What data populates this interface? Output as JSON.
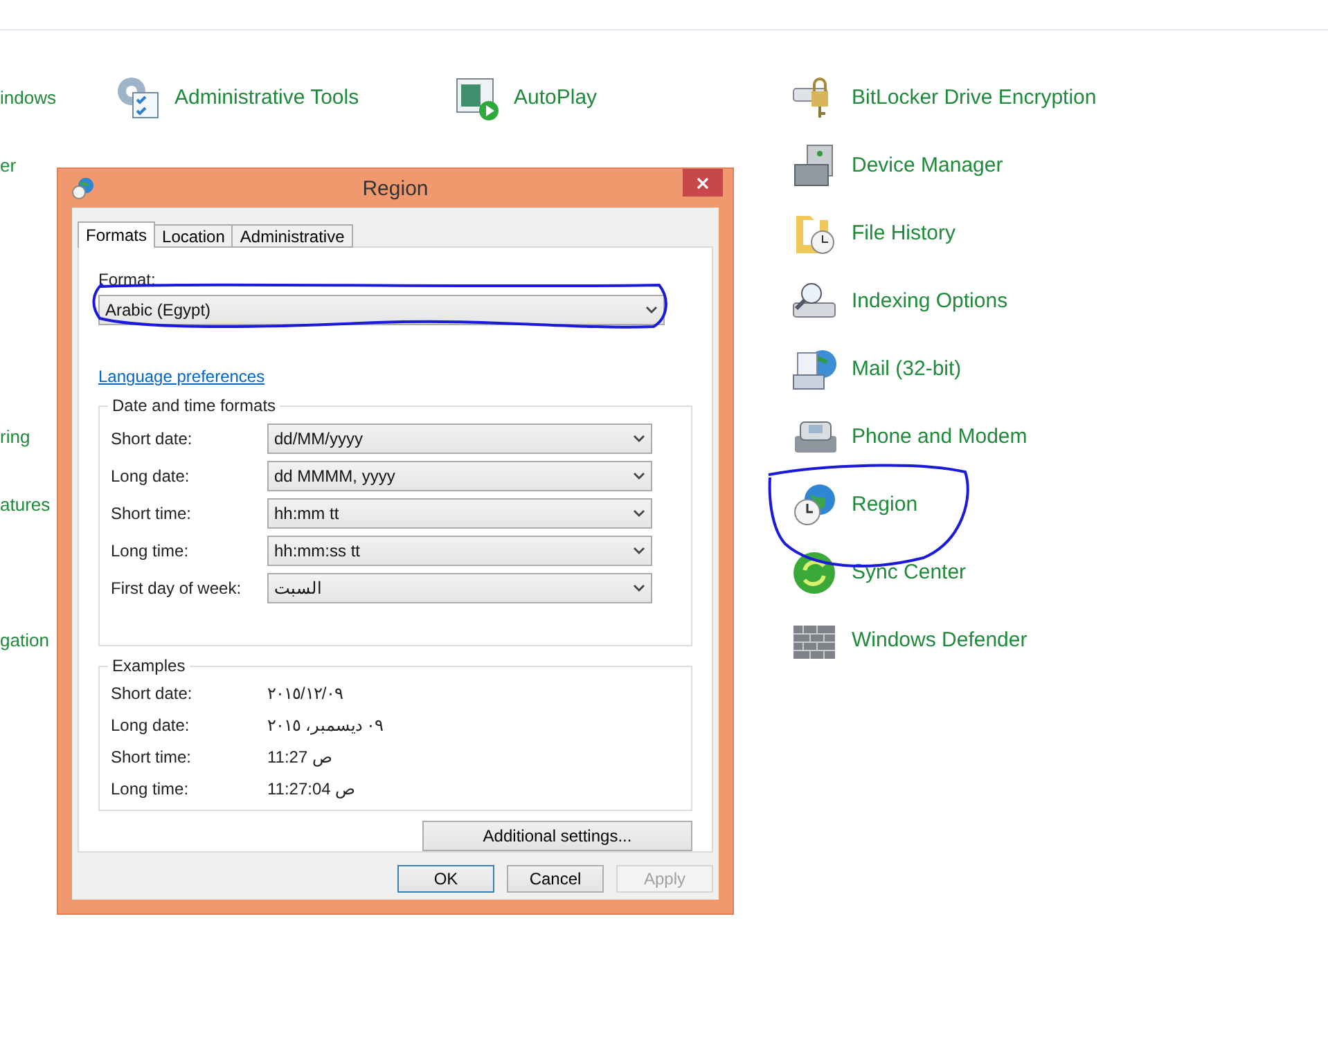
{
  "control_panel": {
    "columns": [
      {
        "groups": [
          {
            "items": [
              {
                "label": "indows"
              },
              {
                "label": "er"
              }
            ]
          },
          {
            "items": [
              {
                "label": "ring"
              },
              {
                "label": "atures"
              }
            ]
          },
          {
            "items": [
              {
                "label": "gation"
              }
            ]
          }
        ]
      },
      {
        "items": [
          {
            "label": "Administrative Tools"
          }
        ]
      },
      {
        "items": [
          {
            "label": "AutoPlay"
          }
        ]
      },
      {
        "items": [
          {
            "label": "BitLocker Drive Encryption"
          },
          {
            "label": "Device Manager"
          },
          {
            "label": "File History"
          },
          {
            "label": "Indexing Options"
          },
          {
            "label": "Mail (32-bit)"
          },
          {
            "label": "Phone and Modem"
          },
          {
            "label": "Region"
          },
          {
            "label": "Sync Center"
          },
          {
            "label": "Windows Defender"
          }
        ]
      }
    ]
  },
  "dialog": {
    "title": "Region",
    "tabs": [
      {
        "label": "Formats",
        "selected": true
      },
      {
        "label": "Location",
        "selected": false
      },
      {
        "label": "Administrative",
        "selected": false
      }
    ],
    "format": {
      "label": "Format:",
      "value": "Arabic (Egypt)"
    },
    "link": "Language preferences",
    "date_time_formats": {
      "title": "Date and time formats",
      "rows": [
        {
          "label": "Short date:",
          "value": "dd/MM/yyyy"
        },
        {
          "label": "Long date:",
          "value": "dd MMMM, yyyy"
        },
        {
          "label": "Short time:",
          "value": "hh:mm tt"
        },
        {
          "label": "Long time:",
          "value": "hh:mm:ss tt"
        },
        {
          "label": "First day of week:",
          "value": "السبت"
        }
      ]
    },
    "examples": {
      "title": "Examples",
      "rows": [
        {
          "label": "Short date:",
          "value": "٢٠١٥/١٢/٠٩"
        },
        {
          "label": "Long date:",
          "value": "٠٩ ديسمبر، ٢٠١٥"
        },
        {
          "label": "Short time:",
          "value": "ص 11:27"
        },
        {
          "label": "Long time:",
          "value": "ص 11:27:04"
        }
      ]
    },
    "additional_button": "Additional settings...",
    "buttons": [
      {
        "label": "OK",
        "disabled": false
      },
      {
        "label": "Cancel",
        "disabled": false
      },
      {
        "label": "Apply",
        "disabled": true
      }
    ]
  }
}
